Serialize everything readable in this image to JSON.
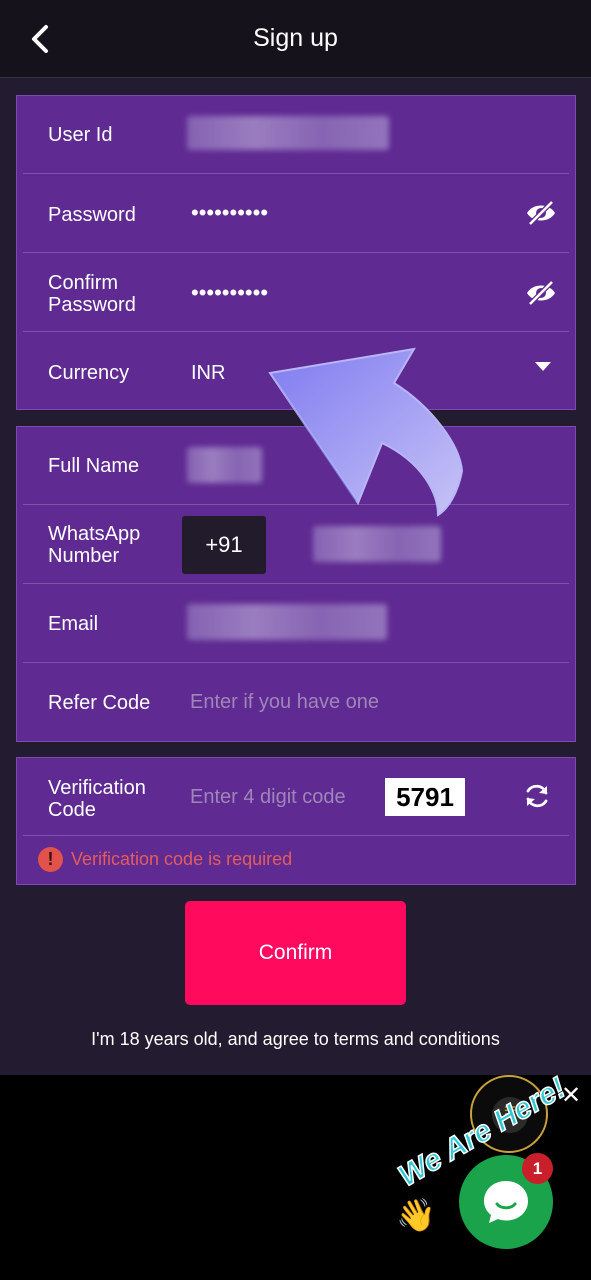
{
  "header": {
    "title": "Sign up",
    "back_icon": "chevron-left-icon"
  },
  "account": {
    "user_id": {
      "label": "User Id"
    },
    "password": {
      "label": "Password",
      "value": "••••••••••",
      "icon": "eye-off-icon"
    },
    "confirm_password": {
      "label_line1": "Confirm",
      "label_line2": "Password",
      "value": "••••••••••",
      "icon": "eye-off-icon"
    },
    "currency": {
      "label": "Currency",
      "value": "INR",
      "icon": "caret-down-icon"
    }
  },
  "personal": {
    "full_name": {
      "label": "Full Name"
    },
    "whatsapp": {
      "label_line1": "WhatsApp",
      "label_line2": "Number",
      "country_code": "+91"
    },
    "email": {
      "label": "Email"
    },
    "refer_code": {
      "label": "Refer Code",
      "placeholder": "Enter if you have one"
    }
  },
  "verification": {
    "label_line1": "Verification",
    "label_line2": "Code",
    "placeholder": "Enter 4 digit code",
    "captcha": "5791",
    "refresh_icon": "refresh-icon",
    "error": "Verification code is required"
  },
  "confirm_button": "Confirm",
  "terms": "I'm 18 years old, and agree to terms and conditions",
  "chat_widget": {
    "tagline": "We Are Here!",
    "badge_count": "1",
    "close": "✕"
  },
  "colors": {
    "background": "#231b2f",
    "card": "#5f2a92",
    "confirm": "#ff0a5d",
    "error": "#e55c5c",
    "chat": "#1aa34a"
  }
}
